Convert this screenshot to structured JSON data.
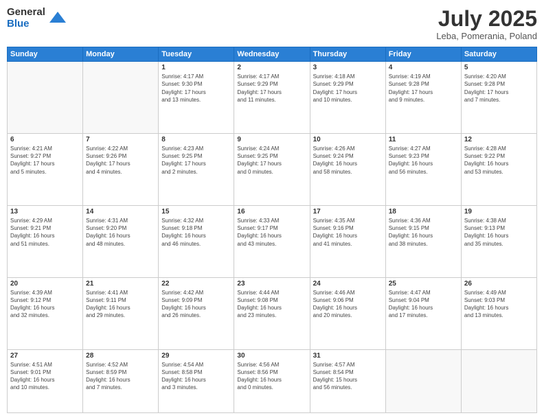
{
  "header": {
    "logo_general": "General",
    "logo_blue": "Blue",
    "title": "July 2025",
    "location": "Leba, Pomerania, Poland"
  },
  "weekdays": [
    "Sunday",
    "Monday",
    "Tuesday",
    "Wednesday",
    "Thursday",
    "Friday",
    "Saturday"
  ],
  "weeks": [
    [
      {
        "day": "",
        "info": ""
      },
      {
        "day": "",
        "info": ""
      },
      {
        "day": "1",
        "info": "Sunrise: 4:17 AM\nSunset: 9:30 PM\nDaylight: 17 hours\nand 13 minutes."
      },
      {
        "day": "2",
        "info": "Sunrise: 4:17 AM\nSunset: 9:29 PM\nDaylight: 17 hours\nand 11 minutes."
      },
      {
        "day": "3",
        "info": "Sunrise: 4:18 AM\nSunset: 9:29 PM\nDaylight: 17 hours\nand 10 minutes."
      },
      {
        "day": "4",
        "info": "Sunrise: 4:19 AM\nSunset: 9:28 PM\nDaylight: 17 hours\nand 9 minutes."
      },
      {
        "day": "5",
        "info": "Sunrise: 4:20 AM\nSunset: 9:28 PM\nDaylight: 17 hours\nand 7 minutes."
      }
    ],
    [
      {
        "day": "6",
        "info": "Sunrise: 4:21 AM\nSunset: 9:27 PM\nDaylight: 17 hours\nand 5 minutes."
      },
      {
        "day": "7",
        "info": "Sunrise: 4:22 AM\nSunset: 9:26 PM\nDaylight: 17 hours\nand 4 minutes."
      },
      {
        "day": "8",
        "info": "Sunrise: 4:23 AM\nSunset: 9:25 PM\nDaylight: 17 hours\nand 2 minutes."
      },
      {
        "day": "9",
        "info": "Sunrise: 4:24 AM\nSunset: 9:25 PM\nDaylight: 17 hours\nand 0 minutes."
      },
      {
        "day": "10",
        "info": "Sunrise: 4:26 AM\nSunset: 9:24 PM\nDaylight: 16 hours\nand 58 minutes."
      },
      {
        "day": "11",
        "info": "Sunrise: 4:27 AM\nSunset: 9:23 PM\nDaylight: 16 hours\nand 56 minutes."
      },
      {
        "day": "12",
        "info": "Sunrise: 4:28 AM\nSunset: 9:22 PM\nDaylight: 16 hours\nand 53 minutes."
      }
    ],
    [
      {
        "day": "13",
        "info": "Sunrise: 4:29 AM\nSunset: 9:21 PM\nDaylight: 16 hours\nand 51 minutes."
      },
      {
        "day": "14",
        "info": "Sunrise: 4:31 AM\nSunset: 9:20 PM\nDaylight: 16 hours\nand 48 minutes."
      },
      {
        "day": "15",
        "info": "Sunrise: 4:32 AM\nSunset: 9:18 PM\nDaylight: 16 hours\nand 46 minutes."
      },
      {
        "day": "16",
        "info": "Sunrise: 4:33 AM\nSunset: 9:17 PM\nDaylight: 16 hours\nand 43 minutes."
      },
      {
        "day": "17",
        "info": "Sunrise: 4:35 AM\nSunset: 9:16 PM\nDaylight: 16 hours\nand 41 minutes."
      },
      {
        "day": "18",
        "info": "Sunrise: 4:36 AM\nSunset: 9:15 PM\nDaylight: 16 hours\nand 38 minutes."
      },
      {
        "day": "19",
        "info": "Sunrise: 4:38 AM\nSunset: 9:13 PM\nDaylight: 16 hours\nand 35 minutes."
      }
    ],
    [
      {
        "day": "20",
        "info": "Sunrise: 4:39 AM\nSunset: 9:12 PM\nDaylight: 16 hours\nand 32 minutes."
      },
      {
        "day": "21",
        "info": "Sunrise: 4:41 AM\nSunset: 9:11 PM\nDaylight: 16 hours\nand 29 minutes."
      },
      {
        "day": "22",
        "info": "Sunrise: 4:42 AM\nSunset: 9:09 PM\nDaylight: 16 hours\nand 26 minutes."
      },
      {
        "day": "23",
        "info": "Sunrise: 4:44 AM\nSunset: 9:08 PM\nDaylight: 16 hours\nand 23 minutes."
      },
      {
        "day": "24",
        "info": "Sunrise: 4:46 AM\nSunset: 9:06 PM\nDaylight: 16 hours\nand 20 minutes."
      },
      {
        "day": "25",
        "info": "Sunrise: 4:47 AM\nSunset: 9:04 PM\nDaylight: 16 hours\nand 17 minutes."
      },
      {
        "day": "26",
        "info": "Sunrise: 4:49 AM\nSunset: 9:03 PM\nDaylight: 16 hours\nand 13 minutes."
      }
    ],
    [
      {
        "day": "27",
        "info": "Sunrise: 4:51 AM\nSunset: 9:01 PM\nDaylight: 16 hours\nand 10 minutes."
      },
      {
        "day": "28",
        "info": "Sunrise: 4:52 AM\nSunset: 8:59 PM\nDaylight: 16 hours\nand 7 minutes."
      },
      {
        "day": "29",
        "info": "Sunrise: 4:54 AM\nSunset: 8:58 PM\nDaylight: 16 hours\nand 3 minutes."
      },
      {
        "day": "30",
        "info": "Sunrise: 4:56 AM\nSunset: 8:56 PM\nDaylight: 16 hours\nand 0 minutes."
      },
      {
        "day": "31",
        "info": "Sunrise: 4:57 AM\nSunset: 8:54 PM\nDaylight: 15 hours\nand 56 minutes."
      },
      {
        "day": "",
        "info": ""
      },
      {
        "day": "",
        "info": ""
      }
    ]
  ]
}
